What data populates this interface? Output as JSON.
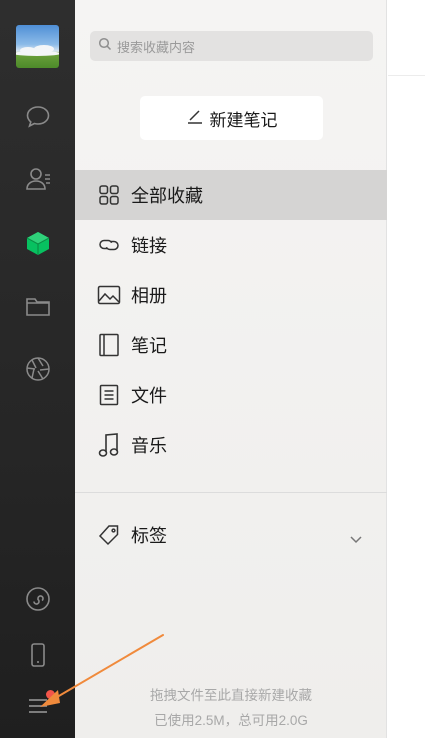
{
  "search": {
    "placeholder": "搜索收藏内容"
  },
  "new_note": {
    "label": "新建笔记"
  },
  "nav": [
    {
      "label": "全部收藏",
      "icon": "grid-icon",
      "active": true
    },
    {
      "label": "链接",
      "icon": "link-icon"
    },
    {
      "label": "相册",
      "icon": "image-icon"
    },
    {
      "label": "笔记",
      "icon": "notebook-icon"
    },
    {
      "label": "文件",
      "icon": "file-icon"
    },
    {
      "label": "音乐",
      "icon": "music-note-icon"
    }
  ],
  "tags": {
    "label": "标签"
  },
  "footer": {
    "drag_hint": "拖拽文件至此直接新建收藏",
    "storage": "已使用2.5M，总可用2.0G"
  },
  "colors": {
    "rail": "#2e2e2e",
    "accent_green": "#07c160",
    "active_bg": "#d5d4d3",
    "badge_red": "#f3554a",
    "annotation_arrow": "#f08a3c"
  }
}
